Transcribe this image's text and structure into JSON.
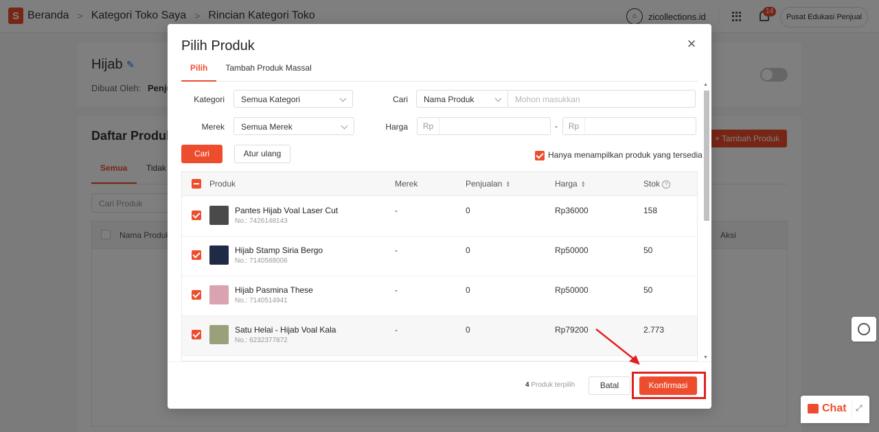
{
  "topbar": {
    "logo_letter": "S",
    "breadcrumbs": [
      "Beranda",
      "Kategori Toko Saya",
      "Rincian Kategori Toko"
    ],
    "shop_name": "zicollections.id",
    "notification_count": "14",
    "edu_button": "Pusat Edukasi Penjual"
  },
  "background": {
    "category_name": "Hijab",
    "created_by_label": "Dibuat Oleh:",
    "created_by_value": "Penju",
    "list_title": "Daftar Produk",
    "add_product_button": "+ Tambah Produk",
    "tab_all": "Semua",
    "tab_inactive": "Tidak",
    "search_placeholder": "Cari Produk",
    "col_name": "Nama Produk",
    "col_action": "Aksi"
  },
  "modal": {
    "title": "Pilih Produk",
    "tabs": [
      {
        "label": "Pilih",
        "active": true
      },
      {
        "label": "Tambah Produk Massal",
        "active": false
      }
    ],
    "filters": {
      "category_label": "Kategori",
      "category_value": "Semua Kategori",
      "brand_label": "Merek",
      "brand_value": "Semua Merek",
      "search_label": "Cari",
      "search_type": "Nama Produk",
      "search_placeholder": "Mohon masukkan",
      "price_label": "Harga",
      "price_prefix": "Rp",
      "price_separator": "-"
    },
    "search_button": "Cari",
    "reset_button": "Atur ulang",
    "available_only_label": "Hanya menampilkan produk yang tersedia",
    "table": {
      "headers": {
        "product": "Produk",
        "brand": "Merek",
        "sales": "Penjualan",
        "price": "Harga",
        "stock": "Stok"
      },
      "rows": [
        {
          "name": "Pantes Hijab Voal Laser Cut",
          "no": "No.: 7426148143",
          "brand": "-",
          "sales": "0",
          "price": "Rp36000",
          "stock": "158",
          "thumb_color": "#4a4a4a"
        },
        {
          "name": "Hijab Stamp Siria Bergo",
          "no": "No.: 7140588006",
          "brand": "-",
          "sales": "0",
          "price": "Rp50000",
          "stock": "50",
          "thumb_color": "#1f2a44"
        },
        {
          "name": "Hijab Pasmina These",
          "no": "No.: 7140514941",
          "brand": "-",
          "sales": "0",
          "price": "Rp50000",
          "stock": "50",
          "thumb_color": "#d9a3b0"
        },
        {
          "name": "Satu Helai - Hijab Voal Kala",
          "no": "No.: 6232377872",
          "brand": "-",
          "sales": "0",
          "price": "Rp79200",
          "stock": "2.773",
          "thumb_color": "#9aa07a"
        }
      ]
    },
    "selected_count": "4",
    "selected_label": "Produk terpilih",
    "cancel_button": "Batal",
    "confirm_button": "Konfirmasi"
  },
  "chat_label": "Chat",
  "colors": {
    "accent": "#ee4d2d",
    "annotation": "#e02020"
  },
  "icons": [
    "close-icon",
    "edit-icon",
    "chevron-down-icon",
    "sort-icon",
    "help-icon",
    "grid-icon",
    "bell-icon",
    "chat-icon",
    "headset-icon"
  ]
}
